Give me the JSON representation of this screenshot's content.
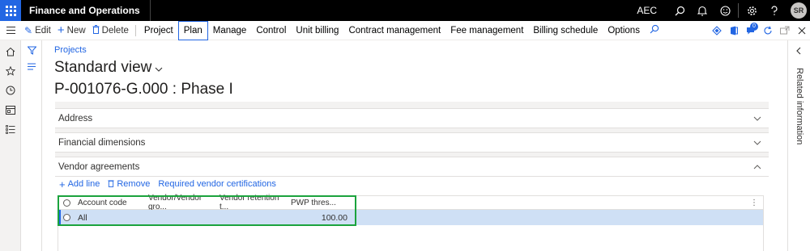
{
  "topbar": {
    "app_title": "Finance and Operations",
    "company": "AEC",
    "avatar_initials": "SR",
    "icons": [
      "search-icon",
      "bell-icon",
      "smiley-icon",
      "gear-icon",
      "help-icon"
    ]
  },
  "actionpane": {
    "edit": "Edit",
    "new": "New",
    "delete": "Delete",
    "tabs": [
      "Project",
      "Plan",
      "Manage",
      "Control",
      "Unit billing",
      "Contract management",
      "Fee management",
      "Billing schedule",
      "Options"
    ],
    "active_tab": "Plan",
    "notification_count": "0"
  },
  "page": {
    "breadcrumb": "Projects",
    "view_name": "Standard view",
    "record_title": "P-001076-G.000 : Phase I"
  },
  "sections": {
    "address": "Address",
    "financial_dimensions": "Financial dimensions",
    "vendor_agreements": "Vendor agreements"
  },
  "vendor_toolbar": {
    "add_line": "Add line",
    "remove": "Remove",
    "required_certifications": "Required vendor certifications"
  },
  "vendor_grid": {
    "columns": [
      "Account code",
      "Vendor/Vendor gro...",
      "Vendor retention t...",
      "PWP thres..."
    ],
    "rows": [
      {
        "account_code": "All",
        "vendor": "",
        "retention": "",
        "pwp_threshold": "100.00"
      }
    ]
  },
  "right_panel": {
    "label": "Related information"
  },
  "colors": {
    "accent": "#2266e3",
    "highlight_box": "#1ba33d",
    "selected_row": "#cfe0f5"
  }
}
